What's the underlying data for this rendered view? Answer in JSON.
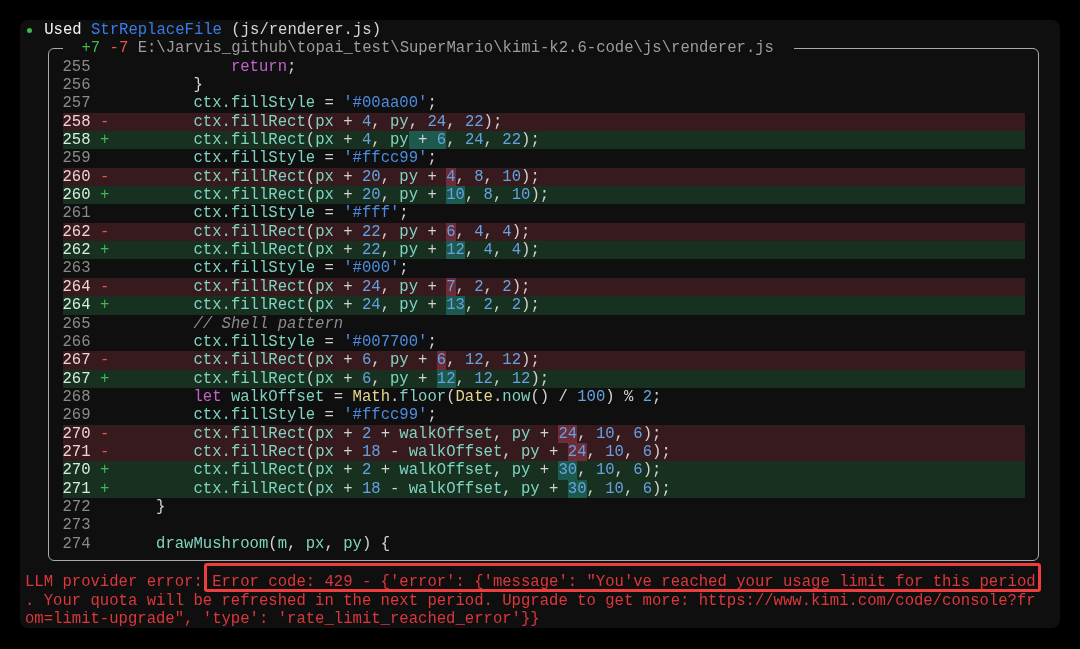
{
  "header": {
    "succeeded": true,
    "action": "Used",
    "tool": "StrReplaceFile",
    "argument": "(js/renderer.js)"
  },
  "diff": {
    "added_count": "+7",
    "removed_count": "-7",
    "path": "E:\\Jarvis_github\\topai_test\\SuperMario\\kimi-k2.6-code\\js\\renderer.js",
    "lines": [
      {
        "number": "255",
        "kind": "context",
        "code": [
          {
            "changed": false,
            "tokens": [
              {
                "text": "            return",
                "kind": "keyword"
              },
              {
                "text": ";",
                "kind": "punct"
              }
            ]
          }
        ]
      },
      {
        "number": "256",
        "kind": "context",
        "code": [
          {
            "changed": false,
            "tokens": [
              {
                "text": "        }",
                "kind": "punct"
              }
            ]
          }
        ]
      },
      {
        "number": "257",
        "kind": "context",
        "code": [
          {
            "changed": false,
            "tokens": [
              {
                "text": "        ctx.fillStyle",
                "kind": "name"
              },
              {
                "text": " = ",
                "kind": "punct"
              },
              {
                "text": "'#00aa00'",
                "kind": "string"
              },
              {
                "text": ";",
                "kind": "punct"
              }
            ]
          }
        ]
      },
      {
        "number": "258",
        "kind": "removed",
        "marker": "-",
        "code": [
          {
            "changed": false,
            "tokens": [
              {
                "text": "        ctx.fillRect",
                "kind": "name"
              },
              {
                "text": "(",
                "kind": "punct"
              },
              {
                "text": "px",
                "kind": "name"
              },
              {
                "text": " + ",
                "kind": "punct"
              },
              {
                "text": "4",
                "kind": "number"
              },
              {
                "text": ", ",
                "kind": "punct"
              },
              {
                "text": "py",
                "kind": "name"
              },
              {
                "text": ", ",
                "kind": "punct"
              },
              {
                "text": "24",
                "kind": "number"
              },
              {
                "text": ", ",
                "kind": "punct"
              },
              {
                "text": "22",
                "kind": "number"
              },
              {
                "text": ");",
                "kind": "punct"
              }
            ]
          }
        ]
      },
      {
        "number": "258",
        "kind": "added",
        "marker": "+",
        "code": [
          {
            "changed": false,
            "tokens": [
              {
                "text": "        ctx.fillRect",
                "kind": "name"
              },
              {
                "text": "(",
                "kind": "punct"
              },
              {
                "text": "px",
                "kind": "name"
              },
              {
                "text": " + ",
                "kind": "punct"
              },
              {
                "text": "4",
                "kind": "number"
              },
              {
                "text": ", ",
                "kind": "punct"
              },
              {
                "text": "py",
                "kind": "name"
              }
            ]
          },
          {
            "changed": true,
            "tokens": [
              {
                "text": " + ",
                "kind": "punct"
              },
              {
                "text": "6",
                "kind": "number"
              }
            ]
          },
          {
            "changed": false,
            "tokens": [
              {
                "text": ", ",
                "kind": "punct"
              },
              {
                "text": "24",
                "kind": "number"
              },
              {
                "text": ", ",
                "kind": "punct"
              },
              {
                "text": "22",
                "kind": "number"
              },
              {
                "text": ");",
                "kind": "punct"
              }
            ]
          }
        ]
      },
      {
        "number": "259",
        "kind": "context",
        "code": [
          {
            "changed": false,
            "tokens": [
              {
                "text": "        ctx.fillStyle",
                "kind": "name"
              },
              {
                "text": " = ",
                "kind": "punct"
              },
              {
                "text": "'#ffcc99'",
                "kind": "string"
              },
              {
                "text": ";",
                "kind": "punct"
              }
            ]
          }
        ]
      },
      {
        "number": "260",
        "kind": "removed",
        "marker": "-",
        "code": [
          {
            "changed": false,
            "tokens": [
              {
                "text": "        ctx.fillRect",
                "kind": "name"
              },
              {
                "text": "(",
                "kind": "punct"
              },
              {
                "text": "px",
                "kind": "name"
              },
              {
                "text": " + ",
                "kind": "punct"
              },
              {
                "text": "20",
                "kind": "number"
              },
              {
                "text": ", ",
                "kind": "punct"
              },
              {
                "text": "py",
                "kind": "name"
              },
              {
                "text": " + ",
                "kind": "punct"
              }
            ]
          },
          {
            "changed": true,
            "tokens": [
              {
                "text": "4",
                "kind": "number"
              }
            ]
          },
          {
            "changed": false,
            "tokens": [
              {
                "text": ", ",
                "kind": "punct"
              },
              {
                "text": "8",
                "kind": "number"
              },
              {
                "text": ", ",
                "kind": "punct"
              },
              {
                "text": "10",
                "kind": "number"
              },
              {
                "text": ");",
                "kind": "punct"
              }
            ]
          }
        ]
      },
      {
        "number": "260",
        "kind": "added",
        "marker": "+",
        "code": [
          {
            "changed": false,
            "tokens": [
              {
                "text": "        ctx.fillRect",
                "kind": "name"
              },
              {
                "text": "(",
                "kind": "punct"
              },
              {
                "text": "px",
                "kind": "name"
              },
              {
                "text": " + ",
                "kind": "punct"
              },
              {
                "text": "20",
                "kind": "number"
              },
              {
                "text": ", ",
                "kind": "punct"
              },
              {
                "text": "py",
                "kind": "name"
              },
              {
                "text": " + ",
                "kind": "punct"
              }
            ]
          },
          {
            "changed": true,
            "tokens": [
              {
                "text": "10",
                "kind": "number"
              }
            ]
          },
          {
            "changed": false,
            "tokens": [
              {
                "text": ", ",
                "kind": "punct"
              },
              {
                "text": "8",
                "kind": "number"
              },
              {
                "text": ", ",
                "kind": "punct"
              },
              {
                "text": "10",
                "kind": "number"
              },
              {
                "text": ");",
                "kind": "punct"
              }
            ]
          }
        ]
      },
      {
        "number": "261",
        "kind": "context",
        "code": [
          {
            "changed": false,
            "tokens": [
              {
                "text": "        ctx.fillStyle",
                "kind": "name"
              },
              {
                "text": " = ",
                "kind": "punct"
              },
              {
                "text": "'#fff'",
                "kind": "string"
              },
              {
                "text": ";",
                "kind": "punct"
              }
            ]
          }
        ]
      },
      {
        "number": "262",
        "kind": "removed",
        "marker": "-",
        "code": [
          {
            "changed": false,
            "tokens": [
              {
                "text": "        ctx.fillRect",
                "kind": "name"
              },
              {
                "text": "(",
                "kind": "punct"
              },
              {
                "text": "px",
                "kind": "name"
              },
              {
                "text": " + ",
                "kind": "punct"
              },
              {
                "text": "22",
                "kind": "number"
              },
              {
                "text": ", ",
                "kind": "punct"
              },
              {
                "text": "py",
                "kind": "name"
              },
              {
                "text": " + ",
                "kind": "punct"
              }
            ]
          },
          {
            "changed": true,
            "tokens": [
              {
                "text": "6",
                "kind": "number"
              }
            ]
          },
          {
            "changed": false,
            "tokens": [
              {
                "text": ", ",
                "kind": "punct"
              },
              {
                "text": "4",
                "kind": "number"
              },
              {
                "text": ", ",
                "kind": "punct"
              },
              {
                "text": "4",
                "kind": "number"
              },
              {
                "text": ");",
                "kind": "punct"
              }
            ]
          }
        ]
      },
      {
        "number": "262",
        "kind": "added",
        "marker": "+",
        "code": [
          {
            "changed": false,
            "tokens": [
              {
                "text": "        ctx.fillRect",
                "kind": "name"
              },
              {
                "text": "(",
                "kind": "punct"
              },
              {
                "text": "px",
                "kind": "name"
              },
              {
                "text": " + ",
                "kind": "punct"
              },
              {
                "text": "22",
                "kind": "number"
              },
              {
                "text": ", ",
                "kind": "punct"
              },
              {
                "text": "py",
                "kind": "name"
              },
              {
                "text": " + ",
                "kind": "punct"
              }
            ]
          },
          {
            "changed": true,
            "tokens": [
              {
                "text": "12",
                "kind": "number"
              }
            ]
          },
          {
            "changed": false,
            "tokens": [
              {
                "text": ", ",
                "kind": "punct"
              },
              {
                "text": "4",
                "kind": "number"
              },
              {
                "text": ", ",
                "kind": "punct"
              },
              {
                "text": "4",
                "kind": "number"
              },
              {
                "text": ");",
                "kind": "punct"
              }
            ]
          }
        ]
      },
      {
        "number": "263",
        "kind": "context",
        "code": [
          {
            "changed": false,
            "tokens": [
              {
                "text": "        ctx.fillStyle",
                "kind": "name"
              },
              {
                "text": " = ",
                "kind": "punct"
              },
              {
                "text": "'#000'",
                "kind": "string"
              },
              {
                "text": ";",
                "kind": "punct"
              }
            ]
          }
        ]
      },
      {
        "number": "264",
        "kind": "removed",
        "marker": "-",
        "code": [
          {
            "changed": false,
            "tokens": [
              {
                "text": "        ctx.fillRect",
                "kind": "name"
              },
              {
                "text": "(",
                "kind": "punct"
              },
              {
                "text": "px",
                "kind": "name"
              },
              {
                "text": " + ",
                "kind": "punct"
              },
              {
                "text": "24",
                "kind": "number"
              },
              {
                "text": ", ",
                "kind": "punct"
              },
              {
                "text": "py",
                "kind": "name"
              },
              {
                "text": " + ",
                "kind": "punct"
              }
            ]
          },
          {
            "changed": true,
            "tokens": [
              {
                "text": "7",
                "kind": "number"
              }
            ]
          },
          {
            "changed": false,
            "tokens": [
              {
                "text": ", ",
                "kind": "punct"
              },
              {
                "text": "2",
                "kind": "number"
              },
              {
                "text": ", ",
                "kind": "punct"
              },
              {
                "text": "2",
                "kind": "number"
              },
              {
                "text": ");",
                "kind": "punct"
              }
            ]
          }
        ]
      },
      {
        "number": "264",
        "kind": "added",
        "marker": "+",
        "code": [
          {
            "changed": false,
            "tokens": [
              {
                "text": "        ctx.fillRect",
                "kind": "name"
              },
              {
                "text": "(",
                "kind": "punct"
              },
              {
                "text": "px",
                "kind": "name"
              },
              {
                "text": " + ",
                "kind": "punct"
              },
              {
                "text": "24",
                "kind": "number"
              },
              {
                "text": ", ",
                "kind": "punct"
              },
              {
                "text": "py",
                "kind": "name"
              },
              {
                "text": " + ",
                "kind": "punct"
              }
            ]
          },
          {
            "changed": true,
            "tokens": [
              {
                "text": "13",
                "kind": "number"
              }
            ]
          },
          {
            "changed": false,
            "tokens": [
              {
                "text": ", ",
                "kind": "punct"
              },
              {
                "text": "2",
                "kind": "number"
              },
              {
                "text": ", ",
                "kind": "punct"
              },
              {
                "text": "2",
                "kind": "number"
              },
              {
                "text": ");",
                "kind": "punct"
              }
            ]
          }
        ]
      },
      {
        "number": "265",
        "kind": "context",
        "code": [
          {
            "changed": false,
            "tokens": [
              {
                "text": "        // Shell pattern",
                "kind": "comment"
              }
            ]
          }
        ]
      },
      {
        "number": "266",
        "kind": "context",
        "code": [
          {
            "changed": false,
            "tokens": [
              {
                "text": "        ctx.fillStyle",
                "kind": "name"
              },
              {
                "text": " = ",
                "kind": "punct"
              },
              {
                "text": "'#007700'",
                "kind": "string"
              },
              {
                "text": ";",
                "kind": "punct"
              }
            ]
          }
        ]
      },
      {
        "number": "267",
        "kind": "removed",
        "marker": "-",
        "code": [
          {
            "changed": false,
            "tokens": [
              {
                "text": "        ctx.fillRect",
                "kind": "name"
              },
              {
                "text": "(",
                "kind": "punct"
              },
              {
                "text": "px",
                "kind": "name"
              },
              {
                "text": " + ",
                "kind": "punct"
              },
              {
                "text": "6",
                "kind": "number"
              },
              {
                "text": ", ",
                "kind": "punct"
              },
              {
                "text": "py",
                "kind": "name"
              },
              {
                "text": " + ",
                "kind": "punct"
              }
            ]
          },
          {
            "changed": true,
            "tokens": [
              {
                "text": "6",
                "kind": "number"
              }
            ]
          },
          {
            "changed": false,
            "tokens": [
              {
                "text": ", ",
                "kind": "punct"
              },
              {
                "text": "12",
                "kind": "number"
              },
              {
                "text": ", ",
                "kind": "punct"
              },
              {
                "text": "12",
                "kind": "number"
              },
              {
                "text": ");",
                "kind": "punct"
              }
            ]
          }
        ]
      },
      {
        "number": "267",
        "kind": "added",
        "marker": "+",
        "code": [
          {
            "changed": false,
            "tokens": [
              {
                "text": "        ctx.fillRect",
                "kind": "name"
              },
              {
                "text": "(",
                "kind": "punct"
              },
              {
                "text": "px",
                "kind": "name"
              },
              {
                "text": " + ",
                "kind": "punct"
              },
              {
                "text": "6",
                "kind": "number"
              },
              {
                "text": ", ",
                "kind": "punct"
              },
              {
                "text": "py",
                "kind": "name"
              },
              {
                "text": " + ",
                "kind": "punct"
              }
            ]
          },
          {
            "changed": true,
            "tokens": [
              {
                "text": "12",
                "kind": "number"
              }
            ]
          },
          {
            "changed": false,
            "tokens": [
              {
                "text": ", ",
                "kind": "punct"
              },
              {
                "text": "12",
                "kind": "number"
              },
              {
                "text": ", ",
                "kind": "punct"
              },
              {
                "text": "12",
                "kind": "number"
              },
              {
                "text": ");",
                "kind": "punct"
              }
            ]
          }
        ]
      },
      {
        "number": "268",
        "kind": "context",
        "code": [
          {
            "changed": false,
            "tokens": [
              {
                "text": "        let",
                "kind": "keyword"
              },
              {
                "text": " walkOffset",
                "kind": "name"
              },
              {
                "text": " = ",
                "kind": "punct"
              },
              {
                "text": "Math",
                "kind": "class"
              },
              {
                "text": ".",
                "kind": "punct"
              },
              {
                "text": "floor",
                "kind": "name"
              },
              {
                "text": "(",
                "kind": "punct"
              },
              {
                "text": "Date",
                "kind": "class"
              },
              {
                "text": ".",
                "kind": "punct"
              },
              {
                "text": "now",
                "kind": "name"
              },
              {
                "text": "() / ",
                "kind": "punct"
              },
              {
                "text": "100",
                "kind": "number"
              },
              {
                "text": ") % ",
                "kind": "punct"
              },
              {
                "text": "2",
                "kind": "number"
              },
              {
                "text": ";",
                "kind": "punct"
              }
            ]
          }
        ]
      },
      {
        "number": "269",
        "kind": "context",
        "code": [
          {
            "changed": false,
            "tokens": [
              {
                "text": "        ctx.fillStyle",
                "kind": "name"
              },
              {
                "text": " = ",
                "kind": "punct"
              },
              {
                "text": "'#ffcc99'",
                "kind": "string"
              },
              {
                "text": ";",
                "kind": "punct"
              }
            ]
          }
        ]
      },
      {
        "number": "270",
        "kind": "removed",
        "marker": "-",
        "code": [
          {
            "changed": false,
            "tokens": [
              {
                "text": "        ctx.fillRect",
                "kind": "name"
              },
              {
                "text": "(",
                "kind": "punct"
              },
              {
                "text": "px",
                "kind": "name"
              },
              {
                "text": " + ",
                "kind": "punct"
              },
              {
                "text": "2",
                "kind": "number"
              },
              {
                "text": " + ",
                "kind": "punct"
              },
              {
                "text": "walkOffset",
                "kind": "name"
              },
              {
                "text": ", ",
                "kind": "punct"
              },
              {
                "text": "py",
                "kind": "name"
              },
              {
                "text": " + ",
                "kind": "punct"
              }
            ]
          },
          {
            "changed": true,
            "tokens": [
              {
                "text": "24",
                "kind": "number"
              }
            ]
          },
          {
            "changed": false,
            "tokens": [
              {
                "text": ", ",
                "kind": "punct"
              },
              {
                "text": "10",
                "kind": "number"
              },
              {
                "text": ", ",
                "kind": "punct"
              },
              {
                "text": "6",
                "kind": "number"
              },
              {
                "text": ");",
                "kind": "punct"
              }
            ]
          }
        ]
      },
      {
        "number": "271",
        "kind": "removed",
        "marker": "-",
        "code": [
          {
            "changed": false,
            "tokens": [
              {
                "text": "        ctx.fillRect",
                "kind": "name"
              },
              {
                "text": "(",
                "kind": "punct"
              },
              {
                "text": "px",
                "kind": "name"
              },
              {
                "text": " + ",
                "kind": "punct"
              },
              {
                "text": "18",
                "kind": "number"
              },
              {
                "text": " - ",
                "kind": "punct"
              },
              {
                "text": "walkOffset",
                "kind": "name"
              },
              {
                "text": ", ",
                "kind": "punct"
              },
              {
                "text": "py",
                "kind": "name"
              },
              {
                "text": " + ",
                "kind": "punct"
              }
            ]
          },
          {
            "changed": true,
            "tokens": [
              {
                "text": "24",
                "kind": "number"
              }
            ]
          },
          {
            "changed": false,
            "tokens": [
              {
                "text": ", ",
                "kind": "punct"
              },
              {
                "text": "10",
                "kind": "number"
              },
              {
                "text": ", ",
                "kind": "punct"
              },
              {
                "text": "6",
                "kind": "number"
              },
              {
                "text": ");",
                "kind": "punct"
              }
            ]
          }
        ]
      },
      {
        "number": "270",
        "kind": "added",
        "marker": "+",
        "code": [
          {
            "changed": false,
            "tokens": [
              {
                "text": "        ctx.fillRect",
                "kind": "name"
              },
              {
                "text": "(",
                "kind": "punct"
              },
              {
                "text": "px",
                "kind": "name"
              },
              {
                "text": " + ",
                "kind": "punct"
              },
              {
                "text": "2",
                "kind": "number"
              },
              {
                "text": " + ",
                "kind": "punct"
              },
              {
                "text": "walkOffset",
                "kind": "name"
              },
              {
                "text": ", ",
                "kind": "punct"
              },
              {
                "text": "py",
                "kind": "name"
              },
              {
                "text": " + ",
                "kind": "punct"
              }
            ]
          },
          {
            "changed": true,
            "tokens": [
              {
                "text": "30",
                "kind": "number"
              }
            ]
          },
          {
            "changed": false,
            "tokens": [
              {
                "text": ", ",
                "kind": "punct"
              },
              {
                "text": "10",
                "kind": "number"
              },
              {
                "text": ", ",
                "kind": "punct"
              },
              {
                "text": "6",
                "kind": "number"
              },
              {
                "text": ");",
                "kind": "punct"
              }
            ]
          }
        ]
      },
      {
        "number": "271",
        "kind": "added",
        "marker": "+",
        "code": [
          {
            "changed": false,
            "tokens": [
              {
                "text": "        ctx.fillRect",
                "kind": "name"
              },
              {
                "text": "(",
                "kind": "punct"
              },
              {
                "text": "px",
                "kind": "name"
              },
              {
                "text": " + ",
                "kind": "punct"
              },
              {
                "text": "18",
                "kind": "number"
              },
              {
                "text": " - ",
                "kind": "punct"
              },
              {
                "text": "walkOffset",
                "kind": "name"
              },
              {
                "text": ", ",
                "kind": "punct"
              },
              {
                "text": "py",
                "kind": "name"
              },
              {
                "text": " + ",
                "kind": "punct"
              }
            ]
          },
          {
            "changed": true,
            "tokens": [
              {
                "text": "30",
                "kind": "number"
              }
            ]
          },
          {
            "changed": false,
            "tokens": [
              {
                "text": ", ",
                "kind": "punct"
              },
              {
                "text": "10",
                "kind": "number"
              },
              {
                "text": ", ",
                "kind": "punct"
              },
              {
                "text": "6",
                "kind": "number"
              },
              {
                "text": ");",
                "kind": "punct"
              }
            ]
          }
        ]
      },
      {
        "number": "272",
        "kind": "context",
        "code": [
          {
            "changed": false,
            "tokens": [
              {
                "text": "    }",
                "kind": "punct"
              }
            ]
          }
        ]
      },
      {
        "number": "273",
        "kind": "context"
      },
      {
        "number": "274",
        "kind": "context",
        "code": [
          {
            "changed": false,
            "tokens": [
              {
                "text": "    drawMushroom",
                "kind": "name"
              },
              {
                "text": "(",
                "kind": "punct"
              },
              {
                "text": "m",
                "kind": "name"
              },
              {
                "text": ", ",
                "kind": "punct"
              },
              {
                "text": "px",
                "kind": "name"
              },
              {
                "text": ", ",
                "kind": "punct"
              },
              {
                "text": "py",
                "kind": "name"
              },
              {
                "text": ") {",
                "kind": "punct"
              }
            ]
          }
        ]
      }
    ]
  },
  "error": {
    "lines": [
      {
        "segments": [
          {
            "text": "LLM provider error:",
            "highlighted": false
          },
          {
            "text": "Error code: 429 - {'error': {'message': \"You've reached your usage limit for this period",
            "highlighted": true
          }
        ]
      },
      {
        "segments": [
          {
            "text": ". Your quota will be refreshed in the next period. Upgrade to get more: https://www.kimi.com/code/console?fr",
            "highlighted": false
          }
        ]
      },
      {
        "segments": [
          {
            "text": "om=limit-upgrade\", 'type': 'rate_limit_reached_error'}}",
            "highlighted": false
          }
        ]
      }
    ]
  }
}
